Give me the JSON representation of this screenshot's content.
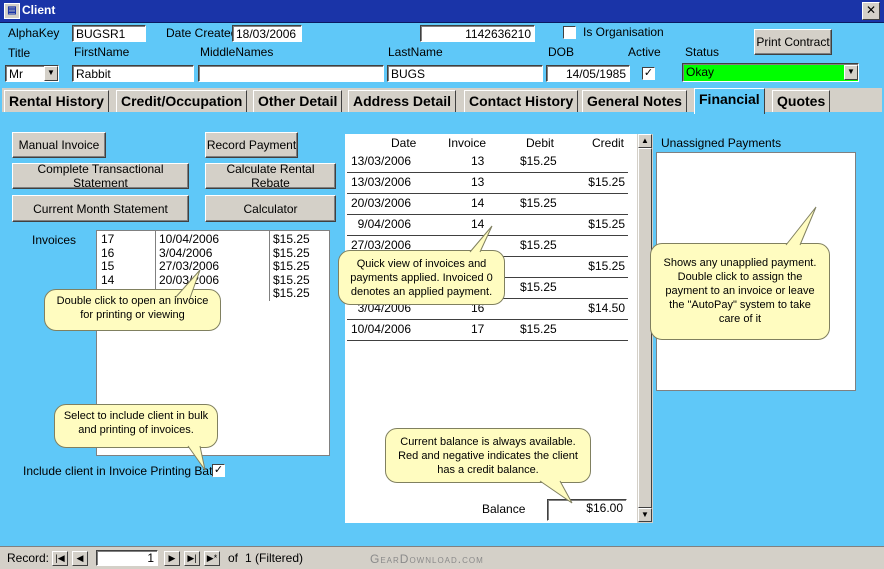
{
  "window": {
    "title": "Client",
    "close_glyph": "✕"
  },
  "header": {
    "alphakey_label": "AlphaKey",
    "alphakey_value": "BUGSR1",
    "date_created_label": "Date Created",
    "date_created_value": "18/03/2006",
    "id_value": "1142636210",
    "is_organisation_label": "Is Organisation",
    "is_organisation_checked": false,
    "print_contract_label": "Print Contract",
    "title_label": "Title",
    "title_value": "Mr",
    "firstname_label": "FirstName",
    "firstname_value": "Rabbit",
    "middlenames_label": "MiddleNames",
    "middlenames_value": "",
    "lastname_label": "LastName",
    "lastname_value": "BUGS",
    "dob_label": "DOB",
    "dob_value": "14/05/1985",
    "active_label": "Active",
    "active_checked": true,
    "status_label": "Status",
    "status_value": "Okay",
    "status_color": "#00ff00"
  },
  "tabs": [
    {
      "label": "Rental History"
    },
    {
      "label": "Credit/Occupation"
    },
    {
      "label": "Other Detail"
    },
    {
      "label": "Address Detail"
    },
    {
      "label": "Contact History"
    },
    {
      "label": "General Notes"
    },
    {
      "label": "Financial",
      "active": true
    },
    {
      "label": "Quotes"
    }
  ],
  "financial": {
    "buttons": {
      "manual_invoice": "Manual Invoice",
      "record_payment": "Record Payment",
      "complete_statement": "Complete Transactional Statement",
      "calculate_rebate": "Calculate Rental Rebate",
      "current_month_statement": "Current Month Statement",
      "calculator": "Calculator"
    },
    "invoices_label": "Invoices",
    "invoices": [
      {
        "num": "17",
        "date": "10/04/2006",
        "amount": "$15.25"
      },
      {
        "num": "16",
        "date": "3/04/2006",
        "amount": "$15.25"
      },
      {
        "num": "15",
        "date": "27/03/2006",
        "amount": "$15.25"
      },
      {
        "num": "14",
        "date": "20/03/2006",
        "amount": "$15.25"
      },
      {
        "num": "",
        "date": "",
        "amount": "$15.25"
      }
    ],
    "include_batch_label": "Include client in Invoice Printing Batch",
    "include_batch_checked": true,
    "grid_headers": {
      "date": "Date",
      "invoice": "Invoice",
      "debit": "Debit",
      "credit": "Credit"
    },
    "transactions": [
      {
        "date": "13/03/2006",
        "invoice": "13",
        "debit": "$15.25",
        "credit": ""
      },
      {
        "date": "13/03/2006",
        "invoice": "13",
        "debit": "",
        "credit": "$15.25"
      },
      {
        "date": "20/03/2006",
        "invoice": "14",
        "debit": "$15.25",
        "credit": ""
      },
      {
        "date": "9/04/2006",
        "invoice": "14",
        "debit": "",
        "credit": "$15.25"
      },
      {
        "date": "27/03/2006",
        "invoice": "",
        "debit": "$15.25",
        "credit": ""
      },
      {
        "date": "",
        "invoice": "",
        "debit": "",
        "credit": "$15.25"
      },
      {
        "date": "",
        "invoice": "",
        "debit": "$15.25",
        "credit": ""
      },
      {
        "date": "3/04/2006",
        "invoice": "16",
        "debit": "",
        "credit": "$14.50"
      },
      {
        "date": "10/04/2006",
        "invoice": "17",
        "debit": "$15.25",
        "credit": ""
      }
    ],
    "balance_label": "Balance",
    "balance_value": "$16.00",
    "unassigned_label": "Unassigned Payments"
  },
  "tooltips": {
    "invoices_tip": "Double click to open an invoice for printing or viewing",
    "batch_tip": "Select to include client in bulk and printing of invoices.",
    "grid_tip": "Quick view of invoices and payments applied.  Invoiced 0 denotes an applied payment.",
    "balance_tip": "Current balance is always available. Red and negative indicates the client has a credit balance.",
    "unassigned_tip": "Shows any unapplied payment. Double click to assign the payment to an invoice or leave the \"AutoPay\" system to take care of it"
  },
  "statusbar": {
    "record_label": "Record:",
    "record_value": "1",
    "of_label": "of",
    "total": "1 (Filtered)",
    "watermark": "GearDownload.com"
  }
}
